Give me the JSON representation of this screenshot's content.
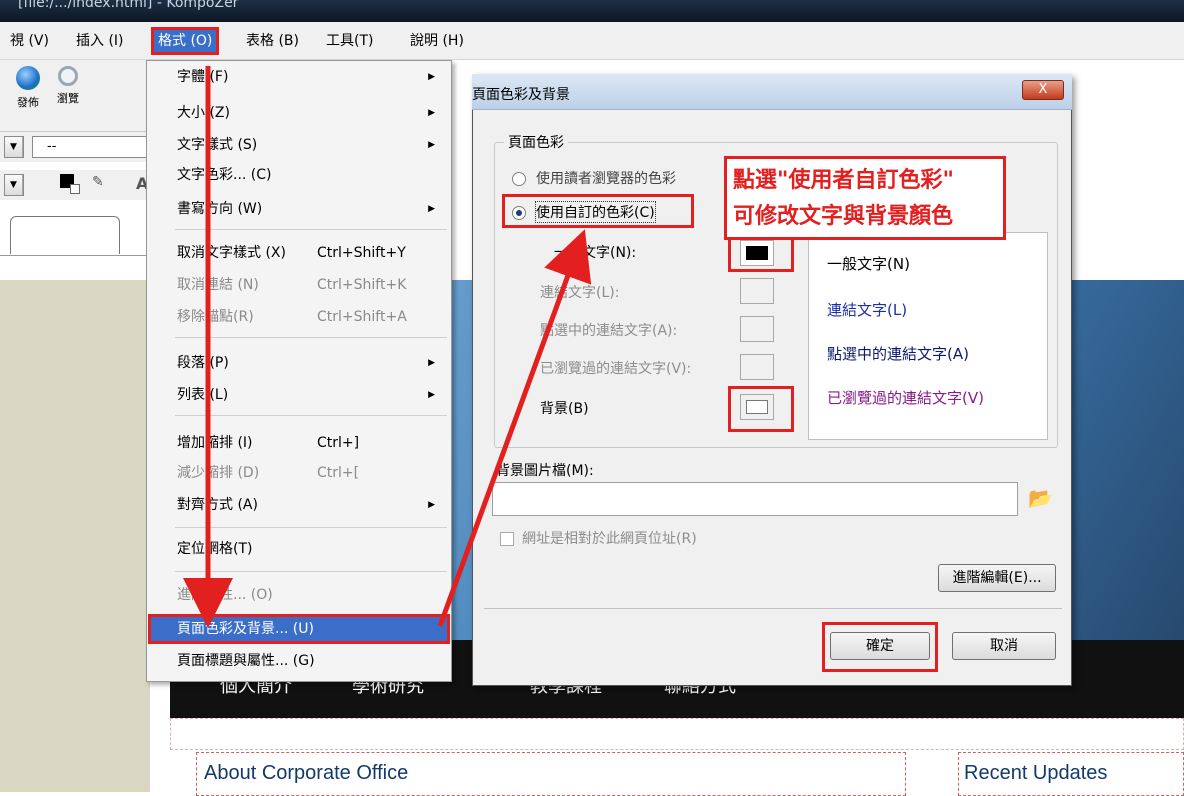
{
  "window": {
    "title": "[file:/.../index.html] - KompoZer"
  },
  "menubar": {
    "items": [
      "視 (V)",
      "插入 (I)",
      "格式 (O)",
      "表格 (B)",
      "工具(T)",
      "說明 (H)"
    ]
  },
  "toolbar": {
    "publish": "發佈",
    "browse": "瀏覽",
    "combo_value": "--"
  },
  "format_menu": {
    "items": [
      {
        "label": "字體 (F)"
      },
      {
        "label": "大小 (Z)"
      },
      {
        "label": "文字樣式 (S)"
      },
      {
        "label": "文字色彩... (C)"
      },
      {
        "label": "書寫方向 (W)"
      },
      {
        "label": "取消文字樣式 (X)",
        "shortcut": "Ctrl+Shift+Y"
      },
      {
        "label": "取消連結 (N)",
        "shortcut": "Ctrl+Shift+K"
      },
      {
        "label": "移除錨點(R)",
        "shortcut": "Ctrl+Shift+A"
      },
      {
        "label": "段落 (P)"
      },
      {
        "label": "列表 (L)"
      },
      {
        "label": "增加縮排 (I)",
        "shortcut": "Ctrl+]"
      },
      {
        "label": "減少縮排 (D)",
        "shortcut": "Ctrl+["
      },
      {
        "label": "對齊方式 (A)"
      },
      {
        "label": "定位網格(T)"
      },
      {
        "label": "進階屬性... (O)"
      },
      {
        "label": "頁面色彩及背景... (U)"
      },
      {
        "label": "頁面標題與屬性... (G)"
      }
    ]
  },
  "dialog": {
    "title": "頁面色彩及背景",
    "close": "X",
    "group_label": "頁面色彩",
    "radio_reader": "使用讀者瀏覽器的色彩",
    "radio_custom": "使用自訂的色彩(C)",
    "normal_text": "一般文字(N):",
    "link_text": "連結文字(L):",
    "active_link": "點選中的連結文字(A):",
    "visited_link": "已瀏覽過的連結文字(V):",
    "background": "背景(B)",
    "preview": {
      "normal": "一般文字(N)",
      "link": "連結文字(L)",
      "active": "點選中的連結文字(A)",
      "visited": "已瀏覽過的連結文字(V)"
    },
    "bg_image_label": "背景圖片檔(M):",
    "bg_image_value": "",
    "relative_url": "網址是相對於此網頁位址(R)",
    "advanced": "進階編輯(E)...",
    "ok": "確定",
    "cancel": "取消"
  },
  "annotation": {
    "line1": "點選\"使用者自訂色彩\"",
    "line2": "可修改文字與背景顏色"
  },
  "webpage": {
    "nav": [
      "個人簡介",
      "學術研究",
      "教學課程",
      "聯絡方式"
    ],
    "about": "About Corporate Office",
    "updates": "Recent Updates"
  },
  "colors": {
    "menu_highlight": "#3a6ec8",
    "annotation_red": "#e32020",
    "link_blue": "#1a2fa8",
    "active_link": "#0c1a6a",
    "visited_link": "#8a1a8a"
  }
}
